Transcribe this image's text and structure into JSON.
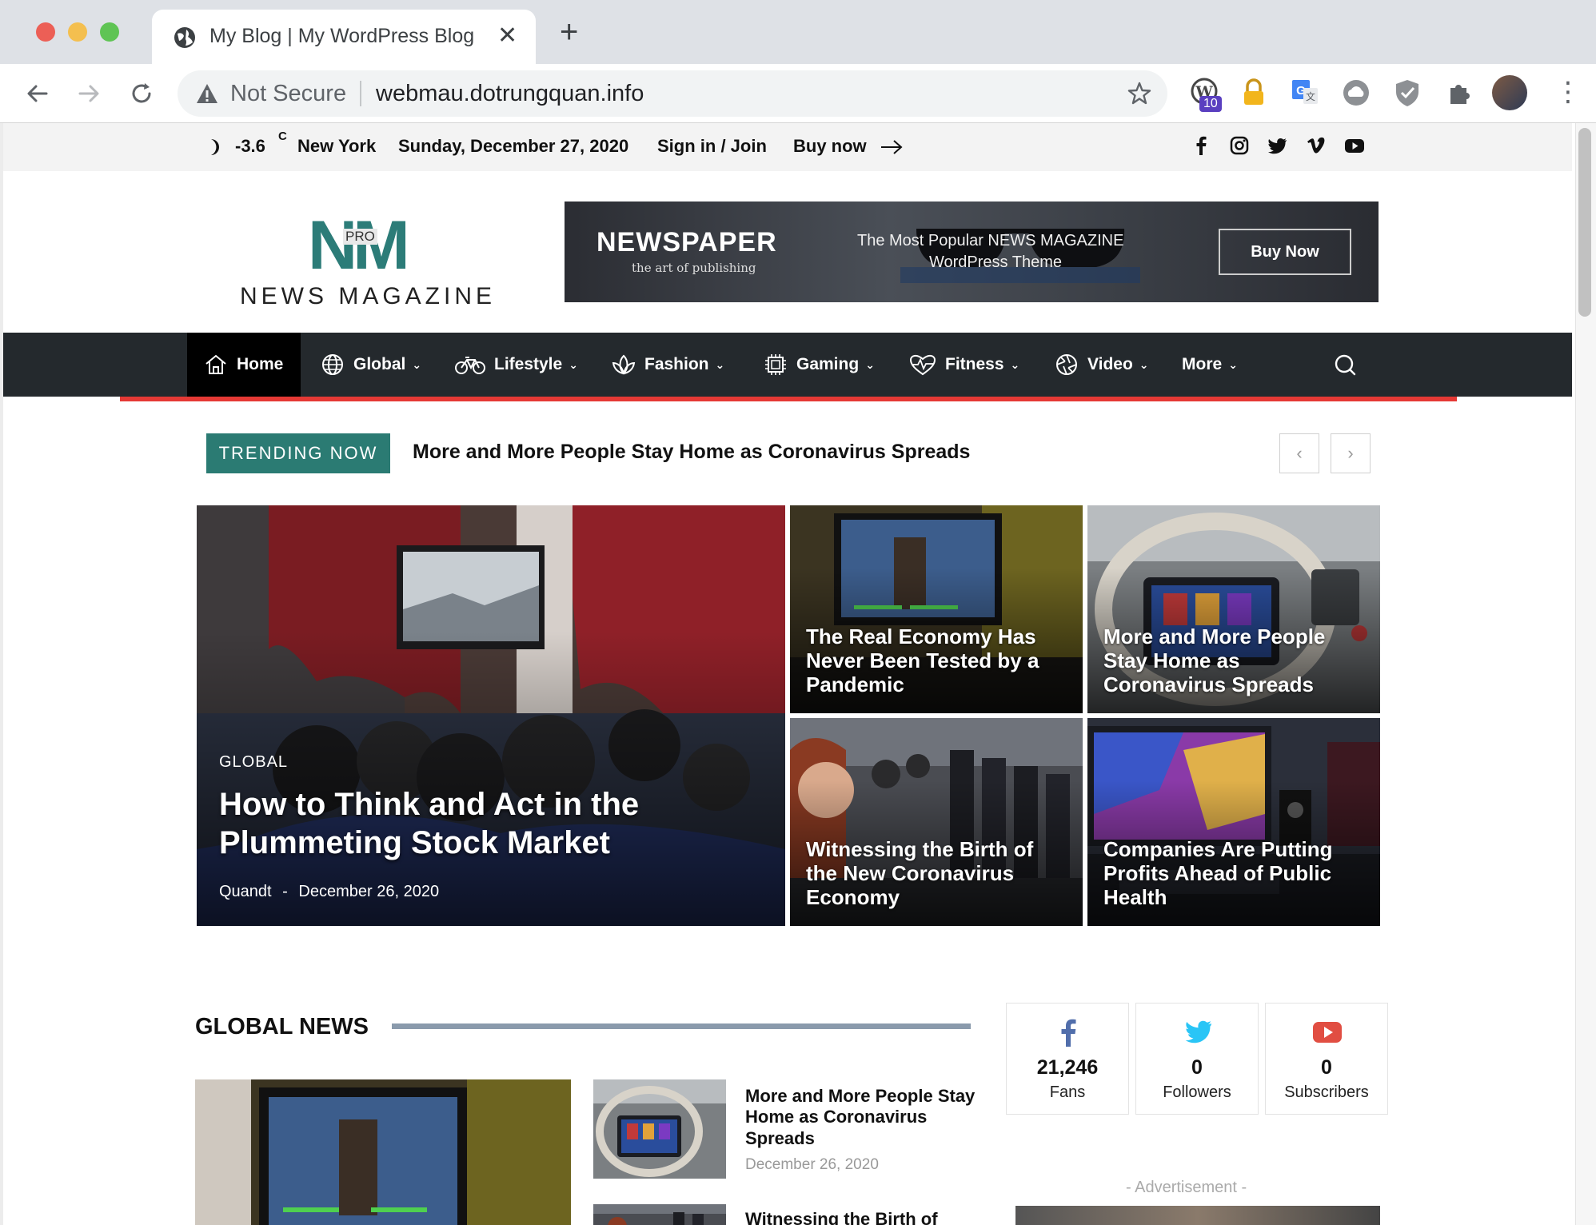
{
  "browser": {
    "tab_title": "My Blog | My WordPress Blog",
    "tab_close": "✕",
    "new_tab": "+",
    "not_secure": "Not Secure",
    "url": "webmau.dotrungquan.info",
    "extension_badge": "10",
    "menu": "⋮"
  },
  "topbar": {
    "temperature": "-3.6",
    "unit": "C",
    "city": "New York",
    "date": "Sunday, December 27, 2020",
    "sign_in": "Sign in / Join",
    "buy_now": "Buy now",
    "social_icons": [
      "facebook-icon",
      "instagram-icon",
      "twitter-icon",
      "vimeo-icon",
      "youtube-icon"
    ]
  },
  "header": {
    "logo_mark": "NM",
    "logo_pro": "PRO",
    "logo_text": "NEWS MAGAZINE",
    "banner": {
      "title": "NEWSPAPER",
      "subtitle": "the art of publishing",
      "tagline_1": "The Most Popular NEWS MAGAZINE",
      "tagline_2": "WordPress Theme",
      "button": "Buy Now"
    }
  },
  "nav": {
    "items": [
      {
        "label": "Home",
        "icon": "home-icon",
        "dropdown": false
      },
      {
        "label": "Global",
        "icon": "globe-icon",
        "dropdown": true
      },
      {
        "label": "Lifestyle",
        "icon": "bicycle-icon",
        "dropdown": true
      },
      {
        "label": "Fashion",
        "icon": "lotus-icon",
        "dropdown": true
      },
      {
        "label": "Gaming",
        "icon": "chip-icon",
        "dropdown": true
      },
      {
        "label": "Fitness",
        "icon": "heartbeat-icon",
        "dropdown": true
      },
      {
        "label": "Video",
        "icon": "aperture-icon",
        "dropdown": true
      },
      {
        "label": "More",
        "icon": "",
        "dropdown": true
      }
    ],
    "chevron": "⌄",
    "accent_color": "#e53935",
    "bg_color": "#24292d"
  },
  "trending": {
    "label": "TRENDING NOW",
    "headline": "More and More People Stay Home as Coronavirus Spreads",
    "prev": "‹",
    "next": "›",
    "label_color": "#2b7b73"
  },
  "featured": {
    "main": {
      "category": "GLOBAL",
      "title": "How to Think and Act in the Plummeting Stock Market",
      "author": "Quandt",
      "separator": "-",
      "date": "December 26, 2020"
    },
    "tiles": [
      {
        "title": "The Real Economy Has Never Been Tested by a Pandemic"
      },
      {
        "title": "More and More People Stay Home as Coronavirus Spreads"
      },
      {
        "title": "Witnessing the Birth of the New Coronavirus Economy"
      },
      {
        "title": "Companies Are Putting Profits Ahead of Public Health"
      }
    ]
  },
  "global_news": {
    "title": "GLOBAL NEWS",
    "items": [
      {
        "title": "More and More People Stay Home as Coronavirus Spreads",
        "date": "December 26, 2020"
      },
      {
        "title": "Witnessing the Birth of"
      }
    ]
  },
  "social_counters": [
    {
      "network": "facebook",
      "count": "21,246",
      "label": "Fans",
      "color": "#516eab"
    },
    {
      "network": "twitter",
      "count": "0",
      "label": "Followers",
      "color": "#29c5f6"
    },
    {
      "network": "youtube",
      "count": "0",
      "label": "Subscribers",
      "color": "#e14e42"
    }
  ],
  "advertisement_label": "- Advertisement -"
}
